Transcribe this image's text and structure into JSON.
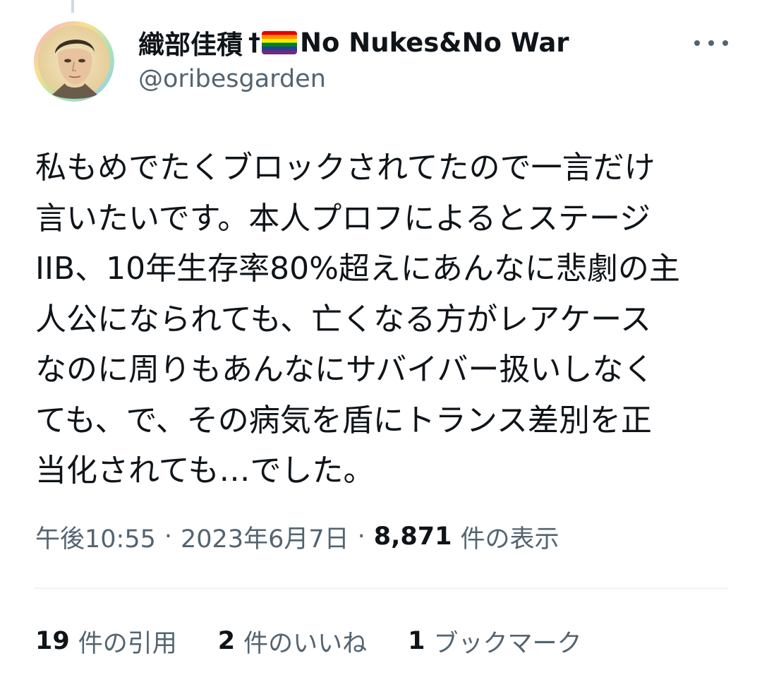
{
  "tweet": {
    "author": {
      "display_name": "織部佳積",
      "name_dagger": "†",
      "flag_icon": "rainbow-flag-icon",
      "name_suffix": "No Nukes&No War",
      "handle": "@oribesgarden",
      "avatar_icon": "avatar-portrait-illustration"
    },
    "more_icon": "more-dots-icon",
    "text_lines": [
      "私もめでたくブロックされてたので一言だけ",
      "言いたいです。本人プロフによるとステージ",
      "IIB、10年生存率80%超えにあんなに悲劇の主",
      "人公になられても、亡くなる方がレアケース",
      "なのに周りもあんなにサバイバー扱いしなく",
      "ても、で、その病気を盾にトランス差別を正",
      "当化されても…でした。"
    ],
    "meta": {
      "time": "午後10:55",
      "separator": "·",
      "date": "2023年6月7日",
      "views_count": "8,871",
      "views_label": "件の表示"
    },
    "stats": [
      {
        "count": "19",
        "label": "件の引用"
      },
      {
        "count": "2",
        "label": "件のいいね"
      },
      {
        "count": "1",
        "label": "ブックマーク"
      }
    ]
  },
  "colors": {
    "text_primary": "#0f1419",
    "text_secondary": "#536471",
    "divider": "#eff3f4",
    "thread_line": "#cfd9de"
  }
}
